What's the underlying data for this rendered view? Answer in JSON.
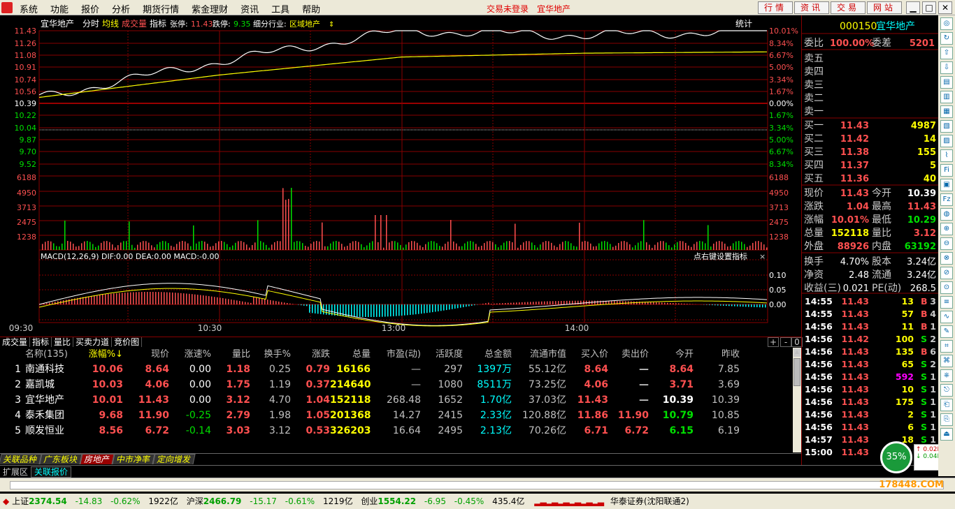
{
  "menu": {
    "items": [
      "系统",
      "功能",
      "报价",
      "分析",
      "期货行情",
      "紫金理财",
      "资讯",
      "工具",
      "帮助"
    ],
    "status1": "交易未登录",
    "status2": "宜华地产",
    "top_buttons": [
      "行情",
      "资讯",
      "交易",
      "网站"
    ]
  },
  "chart": {
    "header": {
      "name": "宜华地产",
      "mode": "分时",
      "avg": "均线",
      "vol": "成交量",
      "ind": "指标",
      "limit_up_label": "张停:",
      "limit_up": "11.43",
      "limit_dn_label": "跌停:",
      "limit_dn": "9.35",
      "sector_label": "细分行业:",
      "sector": "区域地产",
      "stat": "统计"
    },
    "price_left": [
      "11.43",
      "11.26",
      "11.08",
      "10.91",
      "10.74",
      "10.56",
      "10.39",
      "10.22",
      "10.04",
      "9.87",
      "9.70",
      "9.52"
    ],
    "pct_right": [
      "10.01%",
      "8.34%",
      "6.67%",
      "5.00%",
      "3.34%",
      "1.67%",
      "0.00%",
      "1.67%",
      "3.34%",
      "5.00%",
      "6.67%",
      "8.34%"
    ],
    "vol_ticks": [
      "6188",
      "4950",
      "3713",
      "2475",
      "1238"
    ],
    "macd_title": "MACD(12,26,9)  DIF:0.00  DEA:0.00  MACD:-0.00",
    "macd_hint": "点右键设置指标",
    "macd_ticks": [
      "0.10",
      "0.05",
      "0.00"
    ],
    "times": [
      "09:30",
      "10:30",
      "13:00",
      "14:00"
    ]
  },
  "chart_data": {
    "type": "line",
    "title": "宜华地产",
    "x": [
      "09:30",
      "10:30",
      "13:00",
      "14:00",
      "15:00"
    ],
    "series": [
      {
        "name": "分时",
        "values": [
          10.39,
          10.95,
          11.43,
          11.36,
          11.43
        ]
      },
      {
        "name": "均线",
        "values": [
          10.39,
          10.74,
          11.02,
          11.08,
          11.1
        ]
      }
    ],
    "ylim": [
      9.35,
      11.43
    ]
  },
  "tabs1": [
    "成交量",
    "指标",
    "量比",
    "买卖力道",
    "竞价图"
  ],
  "table": {
    "headers": [
      "",
      "名称(135)",
      "涨幅%↓",
      "现价",
      "涨速%",
      "量比",
      "换手%",
      "涨跌",
      "总量",
      "市盈(动)",
      "活跃度",
      "总金额",
      "流通市值",
      "买入价",
      "卖出价",
      "今开",
      "昨收"
    ],
    "rows": [
      [
        "1",
        "南通科技",
        "10.06",
        "8.64",
        "0.00",
        "1.18",
        "0.25",
        "0.79",
        "16166",
        "—",
        "297",
        "1397万",
        "55.12亿",
        "8.64",
        "—",
        "8.64",
        "7.85"
      ],
      [
        "2",
        "嘉凯城",
        "10.03",
        "4.06",
        "0.00",
        "1.75",
        "1.19",
        "0.37",
        "214640",
        "—",
        "1080",
        "8511万",
        "73.25亿",
        "4.06",
        "—",
        "3.71",
        "3.69"
      ],
      [
        "3",
        "宜华地产",
        "10.01",
        "11.43",
        "0.00",
        "3.12",
        "4.70",
        "1.04",
        "152118",
        "268.48",
        "1652",
        "1.70亿",
        "37.03亿",
        "11.43",
        "—",
        "10.39",
        "10.39"
      ],
      [
        "4",
        "泰禾集团",
        "9.68",
        "11.90",
        "-0.25",
        "2.79",
        "1.98",
        "1.05",
        "201368",
        "14.27",
        "2415",
        "2.33亿",
        "120.88亿",
        "11.86",
        "11.90",
        "10.79",
        "10.85"
      ],
      [
        "5",
        "顺发恒业",
        "8.56",
        "6.72",
        "-0.14",
        "3.03",
        "3.12",
        "0.53",
        "326203",
        "16.64",
        "2495",
        "2.13亿",
        "70.26亿",
        "6.71",
        "6.72",
        "6.15",
        "6.19"
      ]
    ]
  },
  "tabs2": [
    "关联品种",
    "广东板块",
    "房地产",
    "中市净率",
    "定向增发"
  ],
  "ext": [
    "扩展区",
    "关联报价"
  ],
  "right": {
    "code": "000150",
    "name": "宜华地产",
    "wb_label": "委比",
    "wb": "100.00%",
    "wc_label": "委差",
    "wc": "5201",
    "sell": [
      "卖五",
      "卖四",
      "卖三",
      "卖二",
      "卖一"
    ],
    "buy": [
      [
        "买一",
        "11.43",
        "4987"
      ],
      [
        "买二",
        "11.42",
        "14"
      ],
      [
        "买三",
        "11.38",
        "155"
      ],
      [
        "买四",
        "11.37",
        "5"
      ],
      [
        "买五",
        "11.36",
        "40"
      ]
    ],
    "stats": [
      [
        "现价",
        "11.43",
        "今开",
        "10.39"
      ],
      [
        "涨跌",
        "1.04",
        "最高",
        "11.43"
      ],
      [
        "涨幅",
        "10.01%",
        "最低",
        "10.29"
      ],
      [
        "总量",
        "152118",
        "量比",
        "3.12"
      ],
      [
        "外盘",
        "88926",
        "内盘",
        "63192"
      ]
    ],
    "stats2": [
      [
        "换手",
        "4.70%",
        "股本",
        "3.24亿"
      ],
      [
        "净资",
        "2.48",
        "流通",
        "3.24亿"
      ],
      [
        "收益(三)",
        "0.021",
        "PE(动)",
        "268.5"
      ]
    ],
    "ticks": [
      [
        "14:55",
        "11.43",
        "13",
        "B",
        "3"
      ],
      [
        "14:55",
        "11.43",
        "57",
        "B",
        "4"
      ],
      [
        "14:56",
        "11.43",
        "11",
        "B",
        "1"
      ],
      [
        "14:56",
        "11.42",
        "100",
        "S",
        "2"
      ],
      [
        "14:56",
        "11.43",
        "135",
        "B",
        "6"
      ],
      [
        "14:56",
        "11.43",
        "65",
        "S",
        "2"
      ],
      [
        "14:56",
        "11.43",
        "592",
        "S",
        "1"
      ],
      [
        "14:56",
        "11.43",
        "10",
        "S",
        "1"
      ],
      [
        "14:56",
        "11.43",
        "175",
        "S",
        "1"
      ],
      [
        "14:56",
        "11.43",
        "2",
        "S",
        "1"
      ],
      [
        "14:56",
        "11.43",
        "6",
        "S",
        "1"
      ],
      [
        "14:57",
        "11.43",
        "18",
        "S",
        "1"
      ],
      [
        "15:00",
        "11.43",
        "",
        "",
        ""
      ]
    ],
    "percent": "35%",
    "up_speed": "0.02K/s",
    "down_speed": "0.04K/s",
    "watermark": "178448.COM"
  },
  "statusbar": {
    "sh_label": "上证",
    "sh": "2374.54",
    "sh_chg": "-14.83",
    "sh_pct": "-0.62%",
    "sh_amt": "1922亿",
    "hs_label": "沪深",
    "hs": "2466.79",
    "hs_chg": "-15.17",
    "hs_pct": "-0.61%",
    "hs_amt": "1219亿",
    "cy_label": "创业",
    "cy": "1554.22",
    "cy_chg": "-6.95",
    "cy_pct": "-0.45%",
    "cy_amt": "435.4亿",
    "broker": "华泰证券(沈阳联通2)"
  }
}
